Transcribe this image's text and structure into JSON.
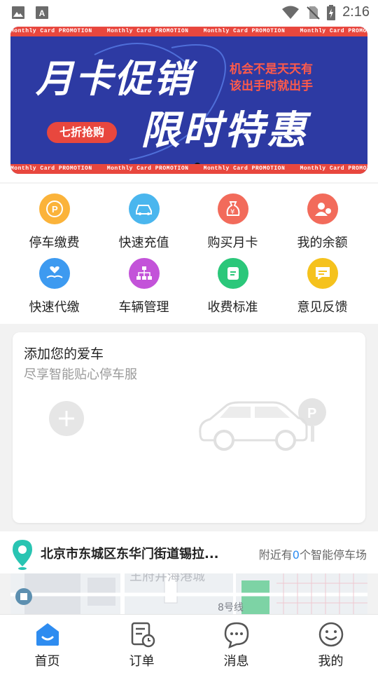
{
  "status_bar": {
    "time": "2:16",
    "left_icons": [
      "image-icon",
      "font-a-icon"
    ],
    "right_icons": [
      "wifi-icon",
      "no-sim-icon",
      "battery-charging-icon"
    ]
  },
  "banner": {
    "stripe_text": "Monthly Card PROMOTION",
    "headline": "月卡促销",
    "subline": "限时特惠",
    "tag_line1": "机会不是天天有",
    "tag_line2": "该出手时就出手",
    "pill": "七折抢购",
    "page_count": 3,
    "active_page": 2,
    "colors": {
      "background": "#2d3aa3",
      "accent": "#e8473e"
    }
  },
  "menu": {
    "items": [
      {
        "label": "停车缴费",
        "icon": "parking-car-icon",
        "color": "#fbb33a"
      },
      {
        "label": "快速充值",
        "icon": "car-recharge-icon",
        "color": "#4ab6ee"
      },
      {
        "label": "购买月卡",
        "icon": "money-bag-icon",
        "color": "#f26b5b"
      },
      {
        "label": "我的余额",
        "icon": "user-balance-icon",
        "color": "#f26b5b"
      },
      {
        "label": "快速代缴",
        "icon": "hand-heart-icon",
        "color": "#3d9af0"
      },
      {
        "label": "车辆管理",
        "icon": "org-chart-icon",
        "color": "#c353d9"
      },
      {
        "label": "收费标准",
        "icon": "document-icon",
        "color": "#2bc77a"
      },
      {
        "label": "意见反馈",
        "icon": "chat-feedback-icon",
        "color": "#f5c21d"
      }
    ]
  },
  "car_card": {
    "title": "添加您的爱车",
    "subtitle": "尽享智能贴心停车服"
  },
  "location": {
    "address": "北京市东城区东华门街道锡拉...",
    "nearby_prefix": "附近有",
    "nearby_count": "0",
    "nearby_suffix": "个智能停车场"
  },
  "map": {
    "label1": "王府井海港城",
    "label2": "8号线"
  },
  "bottom_nav": {
    "items": [
      {
        "label": "首页",
        "icon": "home-icon"
      },
      {
        "label": "订单",
        "icon": "order-clock-icon"
      },
      {
        "label": "消息",
        "icon": "message-icon"
      },
      {
        "label": "我的",
        "icon": "smiley-profile-icon"
      }
    ],
    "active_color": "#2e8cf0"
  }
}
